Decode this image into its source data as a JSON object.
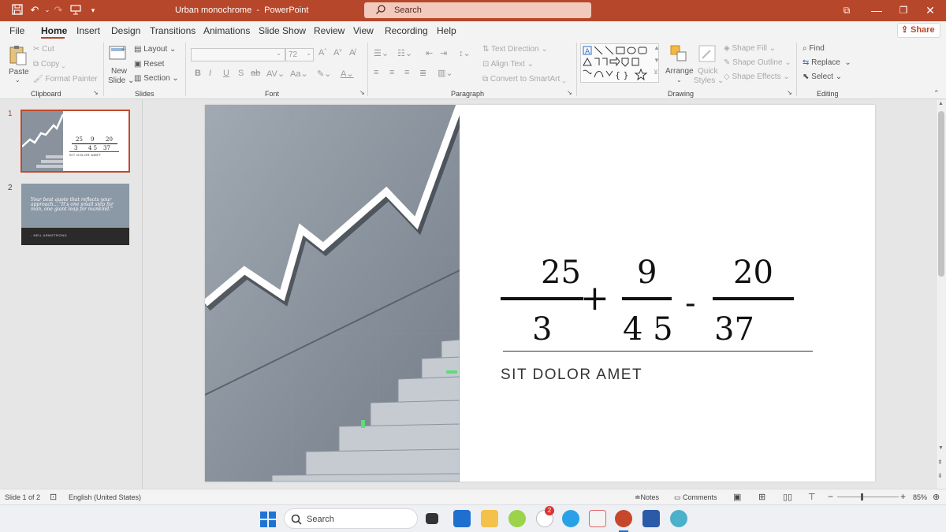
{
  "titlebar": {
    "doc_title": "Urban monochrome",
    "separator": "-",
    "app_name": "PowerPoint",
    "search_placeholder": "Search"
  },
  "menu": {
    "tabs": [
      "File",
      "Home",
      "Insert",
      "Design",
      "Transitions",
      "Animations",
      "Slide Show",
      "Review",
      "View",
      "Recording",
      "Help"
    ],
    "active_tab": "Home",
    "share_label": "Share"
  },
  "ribbon": {
    "clipboard": {
      "paste": "Paste",
      "cut": "Cut",
      "copy": "Copy",
      "format_painter": "Format Painter",
      "label": "Clipboard"
    },
    "slides": {
      "new_slide": "New",
      "new_slide2": "Slide",
      "layout": "Layout",
      "reset": "Reset",
      "section": "Section",
      "label": "Slides"
    },
    "font": {
      "font_size": "72",
      "label": "Font"
    },
    "paragraph": {
      "text_direction": "Text Direction",
      "align_text": "Align Text",
      "convert_smartart": "Convert to SmartArt",
      "label": "Paragraph"
    },
    "drawing": {
      "arrange": "Arrange",
      "quick_styles1": "Quick",
      "quick_styles2": "Styles",
      "shape_fill": "Shape Fill",
      "shape_outline": "Shape Outline",
      "shape_effects": "Shape Effects",
      "label": "Drawing"
    },
    "editing": {
      "find": "Find",
      "replace": "Replace",
      "select": "Select",
      "label": "Editing"
    }
  },
  "slides_pane": {
    "numbers": [
      "1",
      "2"
    ],
    "thumb1": {
      "n1": "25",
      "d1": "3",
      "n2": "9",
      "d2": "4 5",
      "n3": "20",
      "d3": "37",
      "caption": "SIT DOLOR AMET"
    },
    "thumb2": {
      "quote": "Your best quote that reflects your approach... \"It's one small step for man, one giant leap for mankind.\"",
      "author": "- NEIL ARMSTRONG"
    }
  },
  "slide": {
    "numerator1": "25",
    "denominator1": "3",
    "plus": "+",
    "numerator2": "9",
    "denominator2": "4 5",
    "minus": "-",
    "numerator3": "20",
    "denominator3": "37",
    "subtitle": "SIT DOLOR AMET"
  },
  "status": {
    "slide_info": "Slide 1 of 2",
    "language": "English (United States)",
    "notes": "Notes",
    "comments": "Comments",
    "zoom": "85%"
  },
  "taskbar": {
    "search": "Search",
    "badge": "2"
  },
  "colors": {
    "accent": "#b7472a",
    "titlebar": "#b7472a"
  }
}
